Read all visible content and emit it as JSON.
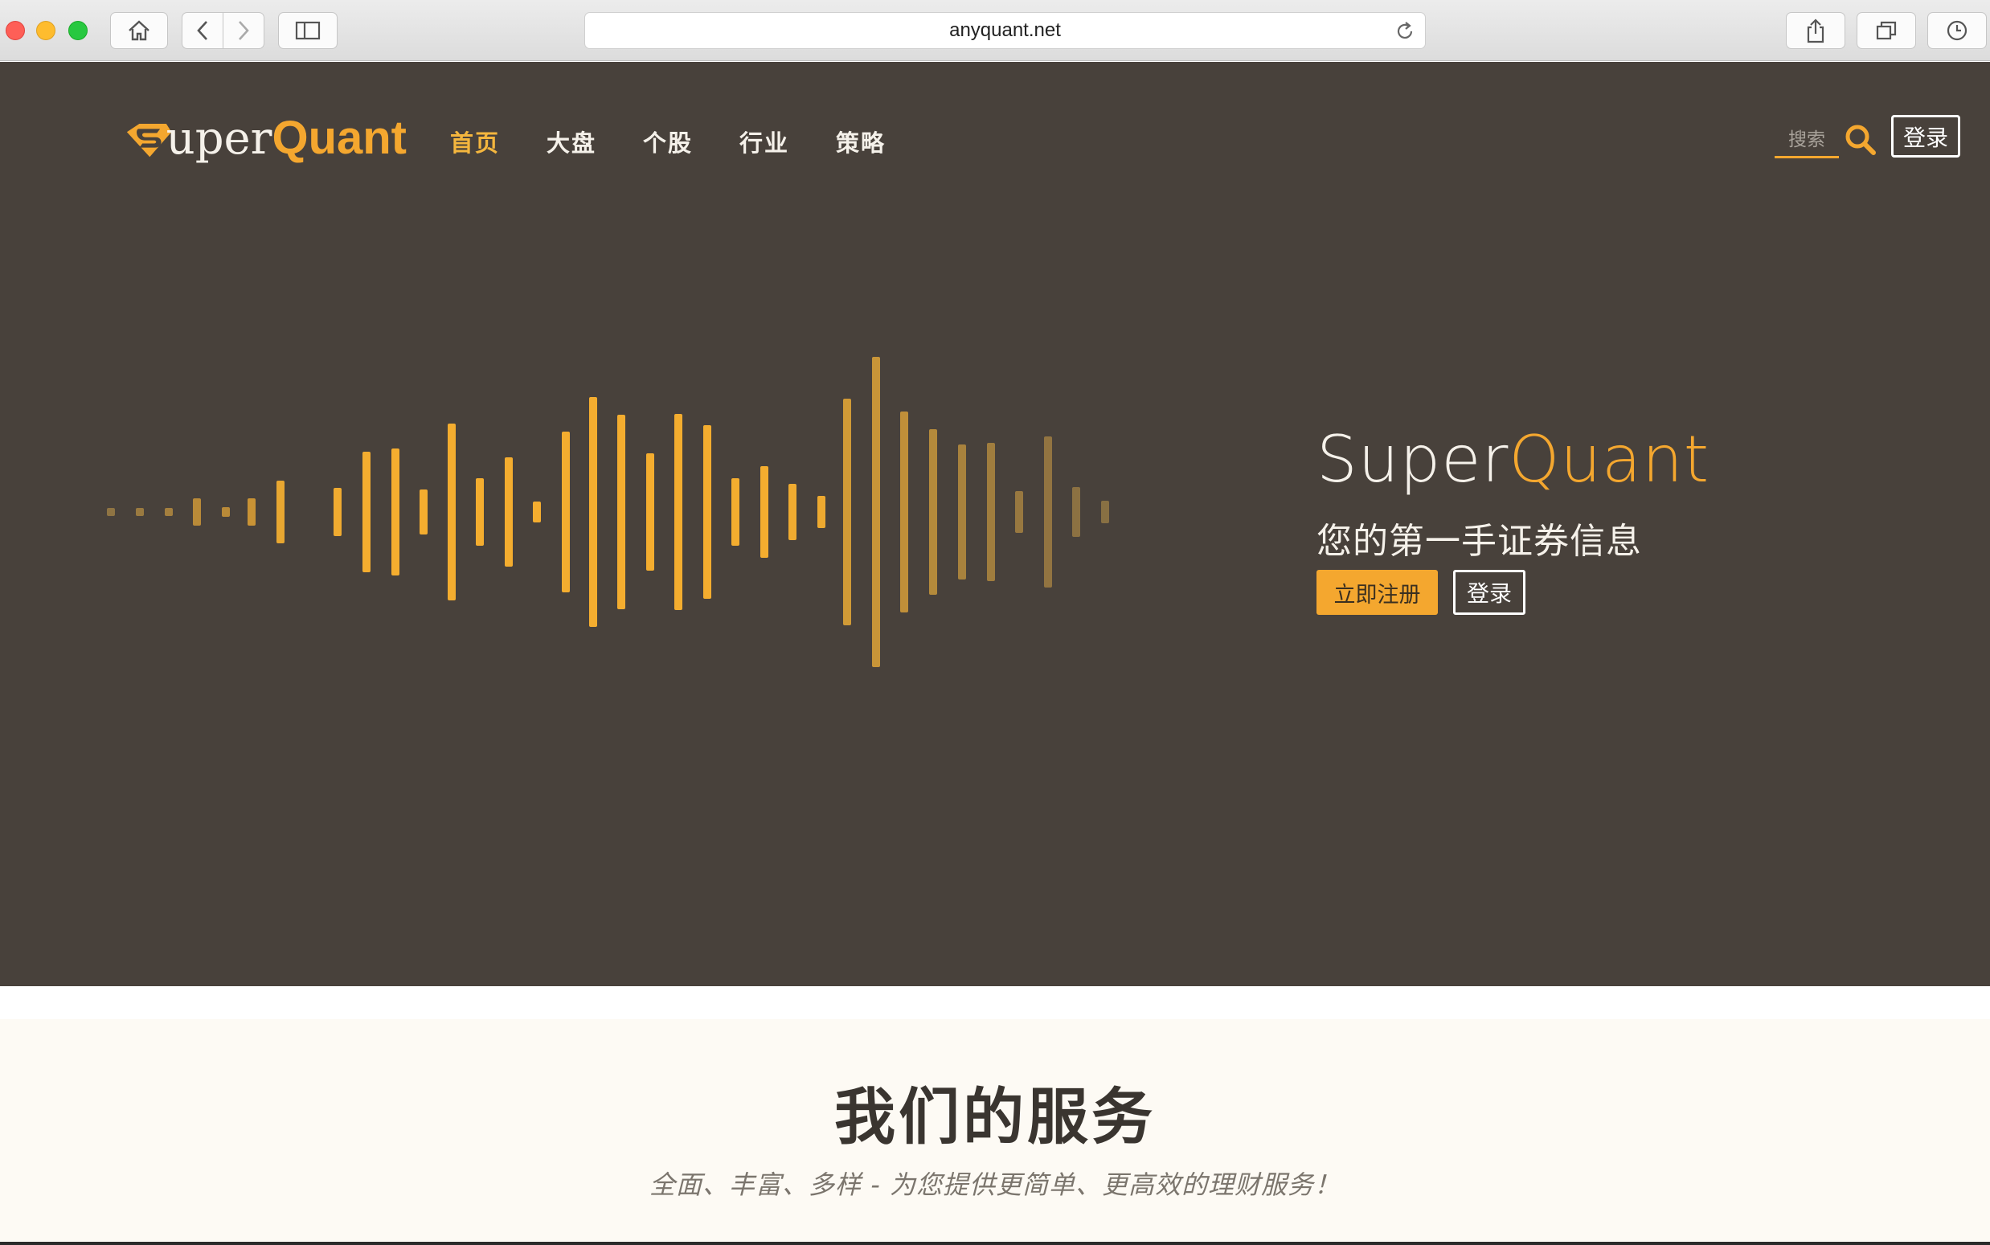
{
  "browser": {
    "url": "anyquant.net"
  },
  "site": {
    "logo": {
      "prefix": "uper",
      "suffix": "Quant"
    },
    "nav": [
      {
        "label": "首页",
        "active": true
      },
      {
        "label": "大盘",
        "active": false
      },
      {
        "label": "个股",
        "active": false
      },
      {
        "label": "行业",
        "active": false
      },
      {
        "label": "策略",
        "active": false
      }
    ],
    "search_placeholder": "搜索",
    "login_label": "登录"
  },
  "hero": {
    "title_part1": "Super",
    "title_part2": "Quant",
    "subtitle": "您的第一手证券信息",
    "register_button": "立即注册",
    "login_button": "登录"
  },
  "services": {
    "title": "我们的服务",
    "subtitle": "全面、丰富、多样 - 为您提供更简单、更高效的理财服务！"
  },
  "colors": {
    "hero_bg": "#48413b",
    "accent": "#f4a72f",
    "services_bg": "#fdfaf4"
  }
}
